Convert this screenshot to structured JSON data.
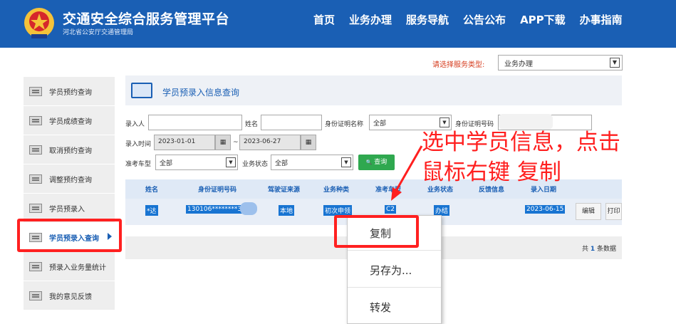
{
  "header": {
    "title": "交通安全综合服务管理平台",
    "subtitle": "河北省公安厅交通管理局",
    "nav": [
      "首页",
      "业务办理",
      "服务导航",
      "公告公布",
      "APP下载",
      "办事指南"
    ]
  },
  "service": {
    "label": "请选择服务类型:",
    "selected": "业务办理"
  },
  "sidebar": {
    "items": [
      {
        "label": "学员预约查询"
      },
      {
        "label": "学员成绩查询"
      },
      {
        "label": "取消预约查询"
      },
      {
        "label": "调整预约查询"
      },
      {
        "label": "学员预录入"
      },
      {
        "label": "学员预录入查询"
      },
      {
        "label": "预录入业务量统计"
      },
      {
        "label": "我的意见反馈"
      }
    ]
  },
  "panel": {
    "title": "学员预录入信息查询"
  },
  "form": {
    "entrant_label": "录入人",
    "name_label": "姓名",
    "id_type_label": "身份证明名称",
    "id_type_value": "全部",
    "id_no_label": "身份证明号码",
    "time_label": "录入时间",
    "date_from": "2023-01-01",
    "date_sep": "~",
    "date_to": "2023-06-27",
    "cal_icon": "▦",
    "vehicle_label": "准考车型",
    "vehicle_value": "全部",
    "status_label": "业务状态",
    "status_value": "全部",
    "query_button": "查询",
    "search_glyph": "🔍"
  },
  "table": {
    "headers": [
      "姓名",
      "身份证明号码",
      "驾驶证来源",
      "业务种类",
      "准考车型",
      "业务状态",
      "反馈信息",
      "录入日期"
    ],
    "row": {
      "name": "*达",
      "id": "130106********3",
      "source": "本地",
      "business": "初次申领",
      "vehicle": "C2",
      "status": "办结",
      "date": "2023-06-15",
      "edit": "编辑",
      "print": "打印"
    },
    "total_prefix": "共",
    "total_count": "1",
    "total_suffix": "条数据"
  },
  "context_menu": {
    "items": [
      "复制",
      "另存为...",
      "转发"
    ]
  },
  "annotation": {
    "line1": "选中学员信息，点击",
    "line2": "鼠标右键 复制"
  },
  "colors": {
    "header_bg": "#1a5fb4",
    "annotation": "#ff1f1f",
    "query_green": "#2fa84f",
    "selection": "#1874d2"
  }
}
